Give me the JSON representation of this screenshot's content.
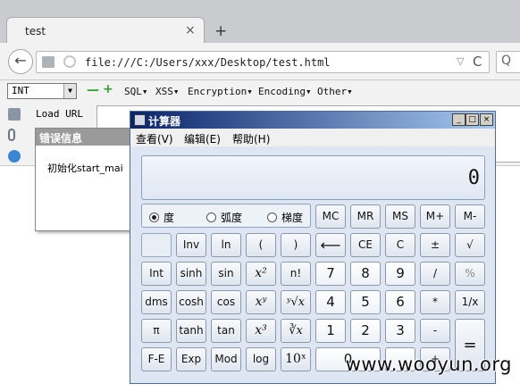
{
  "browser": {
    "tab_title": "test",
    "tab_close": "×",
    "new_tab": "+",
    "url": "file:///C:/Users/xxx/Desktop/test.html",
    "back": "←",
    "reload": "C",
    "search_glyph": "Q"
  },
  "hackbar": {
    "select_value": "INT",
    "minus": "—",
    "plus": "+",
    "menus": [
      "SQL▾",
      "XSS▾",
      "Encryption▾",
      "Encoding▾",
      "Other▾"
    ],
    "load_url": "Load URL"
  },
  "error_panel": {
    "title": "错误信息",
    "body": "初始化start_mai"
  },
  "calculator": {
    "title": "计算器",
    "window_buttons": [
      "_",
      "□",
      "×"
    ],
    "menus": [
      "查看(V)",
      "编辑(E)",
      "帮助(H)"
    ],
    "display": "0",
    "modes": [
      {
        "label": "度",
        "selected": true
      },
      {
        "label": "弧度",
        "selected": false
      },
      {
        "label": "梯度",
        "selected": false
      }
    ],
    "memory_keys": [
      "MC",
      "MR",
      "MS",
      "M+",
      "M-"
    ],
    "row2_sci": [
      "",
      "Inv",
      "ln",
      "(",
      ")"
    ],
    "row2_std": [
      "⟵",
      "CE",
      "C",
      "±",
      "√"
    ],
    "row3_sci": [
      "Int",
      "sinh",
      "sin",
      "x²",
      "n!"
    ],
    "row3_std": [
      "7",
      "8",
      "9",
      "/",
      "%"
    ],
    "row4_sci": [
      "dms",
      "cosh",
      "cos",
      "xʸ",
      "ʸ√x"
    ],
    "row4_std": [
      "4",
      "5",
      "6",
      "*",
      "1/x"
    ],
    "row5_sci": [
      "π",
      "tanh",
      "tan",
      "x³",
      "∛x"
    ],
    "row5_std": [
      "1",
      "2",
      "3",
      "-"
    ],
    "row6_sci": [
      "F-E",
      "Exp",
      "Mod",
      "log",
      "10ˣ"
    ],
    "row6_std": [
      "0",
      ".",
      "+"
    ],
    "equals": "="
  },
  "watermark": "www.wooyun.org"
}
